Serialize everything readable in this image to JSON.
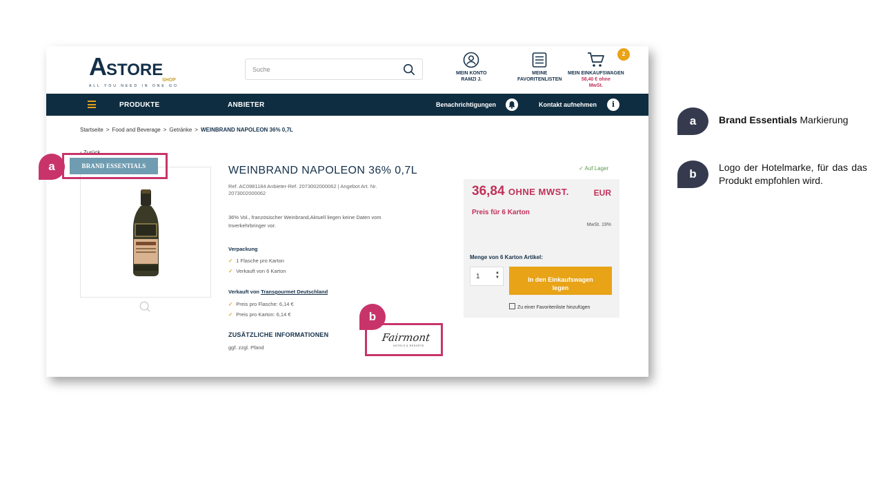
{
  "header": {
    "logo_main": "A",
    "logo_rest": "STORE",
    "logo_shop": "SHOP",
    "logo_tagline": "ALL YOU NEED IN ONE GO",
    "search_placeholder": "Suche",
    "account_label": "MEIN KONTO",
    "account_user": "RAMZI J.",
    "favorites_line1": "MEINE",
    "favorites_line2": "FAVORITENLISTEN",
    "cart_label": "MEIN EINKAUFSWAGEN",
    "cart_amount_line1": "58,40 € ohne",
    "cart_amount_line2": "MwSt.",
    "cart_count": "2"
  },
  "nav": {
    "products": "PRODUKTE",
    "vendors": "ANBIETER",
    "notifications": "Benachrichtigungen",
    "contact": "Kontakt aufnehmen"
  },
  "breadcrumb": {
    "items": [
      "Startseite",
      "Food and Beverage",
      "Getränke"
    ],
    "current": "WEINBRAND NAPOLEON 36% 0,7L",
    "separator": ">"
  },
  "back_label": "Zurück",
  "brand_badge": "BRAND ESSENTIALS",
  "product": {
    "title": "WEINBRAND NAPOLEON 36% 0,7L",
    "ref_line1": "Ref. AC0981184   Anbieter-Ref. 2073002000062 | Angebot Art. Nr.",
    "ref_line2": "2073002000062",
    "description": "36% Vol., französischer Weinbrand,Aktuell liegen keine Daten vom Inverkehrbringer vor.",
    "packaging_title": "Verpackung",
    "packaging_items": [
      "1 Flasche pro Karton",
      "Verkauft von 6 Karton"
    ],
    "sold_by_prefix": "Verkauft von",
    "sold_by_name": "Transgourmet Deutschland",
    "price_items": [
      "Preis pro Flasche: 6,14 €",
      "Preis pro Karton: 6,14 €"
    ],
    "additional_title": "ZUSÄTZLICHE INFORMATIONEN",
    "deposit": "ggf. zzgl. Pfand",
    "hotel_logo_text": "Fairmont",
    "hotel_logo_sub": "HOTELS & RESORTS"
  },
  "pricing": {
    "stock": "Auf Lager",
    "price": "36,84",
    "price_suffix": "OHNE MWST.",
    "currency": "EUR",
    "unit": "Preis für 6 Karton",
    "vat": "MwSt. 19%",
    "qty_label": "Menge von 6 Karton Artikel:",
    "qty_value": "1",
    "add_to_cart_line1": "In den Einkaufswagen",
    "add_to_cart_line2": "legen",
    "favorites_link": "Zu einer Favoritenliste hinzufügen"
  },
  "annotations": {
    "a_letter": "a",
    "b_letter": "b",
    "a_bold": "Brand Essentials",
    "a_rest": "Markierung",
    "b_text": "Logo der Hotelmarke, für das das Produkt empfohlen wird."
  },
  "colors": {
    "navy": "#0f2d40",
    "accent_gold": "#e8a317",
    "price_red": "#c0305a",
    "annotation_pink": "#c8346a",
    "badge_blue": "#6f9cb0",
    "legend_dark": "#363a4e"
  }
}
